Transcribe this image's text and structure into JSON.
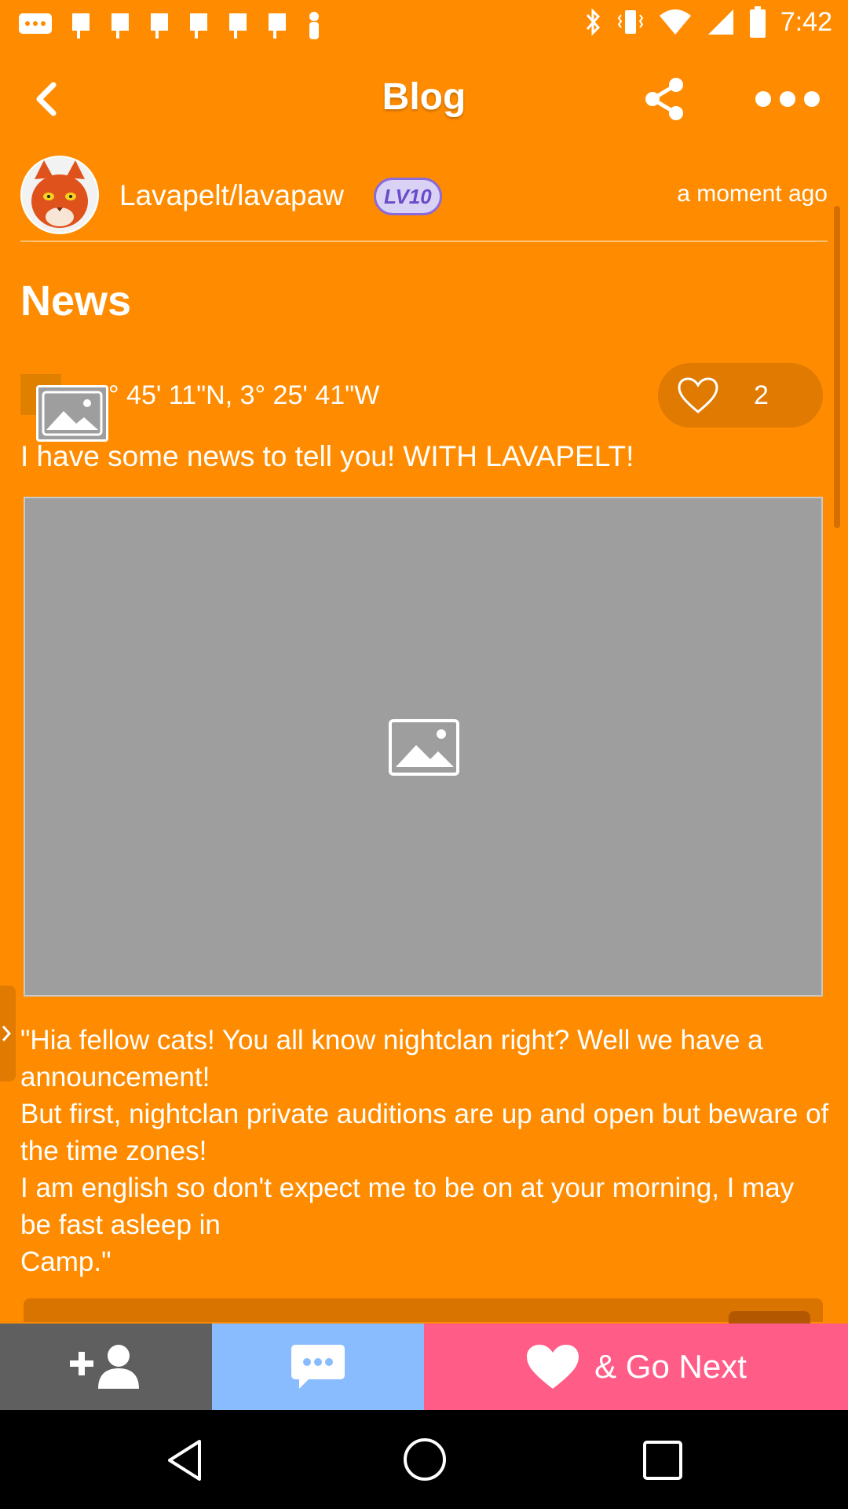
{
  "status_bar": {
    "time": "7:42",
    "icons": [
      "message-icon",
      "flag-icon",
      "flag-icon",
      "flag-icon",
      "flag-icon",
      "flag-icon",
      "flag-icon",
      "person-icon",
      "bluetooth-icon",
      "vibrate-icon",
      "wifi-icon",
      "signal-icon",
      "battery-icon"
    ]
  },
  "app_bar": {
    "title": "Blog",
    "back_icon": "chevron-left-icon",
    "share_icon": "share-icon",
    "more_icon": "more-dots-icon"
  },
  "author": {
    "name": "Lavapelt/lavapaw",
    "level": "LV10",
    "time": "a moment ago"
  },
  "post": {
    "title": "News",
    "location": "° 45' 11\"N, 3° 25' 41\"W",
    "likes": "2",
    "subtitle": "I have some news to tell you! WITH LAVAPELT!",
    "body": "\"Hia fellow cats! You all know nightclan right? Well we have a announcement!\nBut first, nightclan private auditions are up and open but beware of the time zones!\nI am english so don't expect me to be on at your morning, I may be fast asleep in\nCamp.\""
  },
  "bottom_actions": {
    "follow_icon": "add-user-icon",
    "chat_icon": "chat-icon",
    "like_next_label": "& Go Next"
  },
  "colors": {
    "background": "#FF8C00",
    "follow": "#5F5F5F",
    "chat": "#89BBFF",
    "like_next": "#FF5C87"
  }
}
